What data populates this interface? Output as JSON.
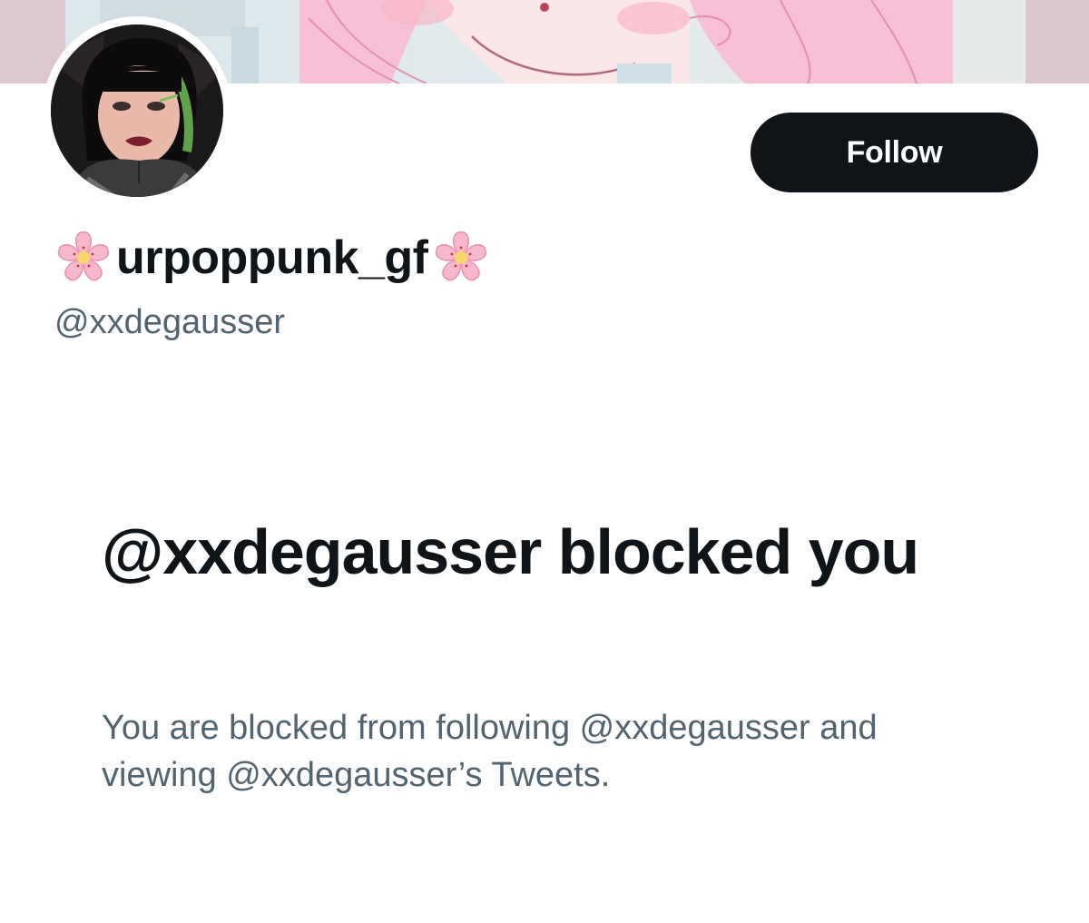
{
  "profile": {
    "display_name": "urpoppunk_gf",
    "name_emoji": "cherry-blossom-icon",
    "handle": "@xxdegausser",
    "follow_label": "Follow"
  },
  "blocked": {
    "title": "@xxdegausser blocked you",
    "description": "You are blocked from following @xxdegausser and viewing @xxdegausser’s Tweets."
  },
  "colors": {
    "primary_text": "#0f1419",
    "secondary_text": "#536471",
    "button_bg": "#0f1419",
    "button_text": "#ffffff",
    "banner_pink": "#f4b8d0"
  }
}
